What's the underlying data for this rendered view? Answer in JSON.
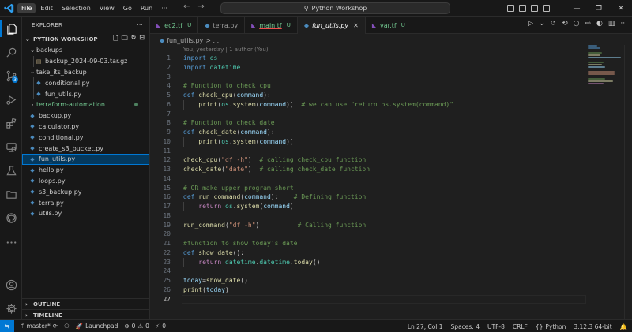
{
  "window": {
    "menu": [
      "File",
      "Edit",
      "Selection",
      "View",
      "Go",
      "Run",
      "···"
    ],
    "search_title": "Python Workshop",
    "controls": [
      "—",
      "❐",
      "✕"
    ]
  },
  "explorer": {
    "header": "EXPLORER",
    "header_more": "···",
    "project": "PYTHON WORKSHOP",
    "tree": [
      {
        "label": "backups",
        "type": "folder",
        "open": true,
        "depth": 0
      },
      {
        "label": "backup_2024-09-03.tar.gz",
        "type": "tar",
        "depth": 1
      },
      {
        "label": "take_its_backup",
        "type": "folder",
        "open": true,
        "depth": 0
      },
      {
        "label": "conditional.py",
        "type": "py",
        "depth": 1
      },
      {
        "label": "fun_utils.py",
        "type": "py",
        "depth": 1
      },
      {
        "label": "terraform-automation",
        "type": "folder",
        "open": false,
        "depth": 0,
        "untracked": true
      },
      {
        "label": "backup.py",
        "type": "py",
        "depth": 0
      },
      {
        "label": "calculator.py",
        "type": "py",
        "depth": 0
      },
      {
        "label": "conditional.py",
        "type": "py",
        "depth": 0
      },
      {
        "label": "create_s3_bucket.py",
        "type": "py",
        "depth": 0
      },
      {
        "label": "fun_utils.py",
        "type": "py",
        "depth": 0,
        "selected": true
      },
      {
        "label": "hello.py",
        "type": "py",
        "depth": 0
      },
      {
        "label": "loops.py",
        "type": "py",
        "depth": 0
      },
      {
        "label": "s3_backup.py",
        "type": "py",
        "depth": 0
      },
      {
        "label": "terra.py",
        "type": "py",
        "depth": 0
      },
      {
        "label": "utils.py",
        "type": "py",
        "depth": 0
      }
    ],
    "outline": "OUTLINE",
    "timeline": "TIMELINE"
  },
  "activity": {
    "scm_badge": "3"
  },
  "tabs": [
    {
      "label": "ec2.tf",
      "icon": "tf",
      "status": "U",
      "active": false
    },
    {
      "label": "terra.py",
      "icon": "py",
      "status": "",
      "active": false
    },
    {
      "label": "main.tf",
      "icon": "tf",
      "status": "U",
      "active": false
    },
    {
      "label": "fun_utils.py",
      "icon": "py",
      "status": "",
      "active": true,
      "close": "✕"
    },
    {
      "label": "var.tf",
      "icon": "tf",
      "status": "U",
      "active": false
    }
  ],
  "breadcrumb": {
    "file": "fun_utils.py",
    "rest": "> ..."
  },
  "blame": "You, yesterday | 1 author (You)",
  "cursor_line": 27,
  "code": [
    [
      [
        "kw",
        "import"
      ],
      [
        "plain",
        " "
      ],
      [
        "mod",
        "os"
      ]
    ],
    [
      [
        "kw",
        "import"
      ],
      [
        "plain",
        " "
      ],
      [
        "mod",
        "datetime"
      ]
    ],
    [],
    [
      [
        "com",
        "# Function to check cpu"
      ]
    ],
    [
      [
        "kw",
        "def"
      ],
      [
        "plain",
        " "
      ],
      [
        "fn",
        "check_cpu"
      ],
      [
        "plain",
        "("
      ],
      [
        "var",
        "command"
      ],
      [
        "plain",
        "):"
      ]
    ],
    [
      [
        "plain",
        "    "
      ],
      [
        "fn",
        "print"
      ],
      [
        "plain",
        "("
      ],
      [
        "mod",
        "os"
      ],
      [
        "plain",
        "."
      ],
      [
        "fn",
        "system"
      ],
      [
        "plain",
        "("
      ],
      [
        "var",
        "command"
      ],
      [
        "plain",
        "))  "
      ],
      [
        "com",
        "# we can use \"return os.system(command)\""
      ]
    ],
    [],
    [
      [
        "com",
        "# Function to check date"
      ]
    ],
    [
      [
        "kw",
        "def"
      ],
      [
        "plain",
        " "
      ],
      [
        "fn",
        "check_date"
      ],
      [
        "plain",
        "("
      ],
      [
        "var",
        "command"
      ],
      [
        "plain",
        "):"
      ]
    ],
    [
      [
        "plain",
        "    "
      ],
      [
        "fn",
        "print"
      ],
      [
        "plain",
        "("
      ],
      [
        "mod",
        "os"
      ],
      [
        "plain",
        "."
      ],
      [
        "fn",
        "system"
      ],
      [
        "plain",
        "("
      ],
      [
        "var",
        "command"
      ],
      [
        "plain",
        "))"
      ]
    ],
    [],
    [
      [
        "fn",
        "check_cpu"
      ],
      [
        "plain",
        "("
      ],
      [
        "str",
        "\"df -h\""
      ],
      [
        "plain",
        ")  "
      ],
      [
        "com",
        "# calling check_cpu function"
      ]
    ],
    [
      [
        "fn",
        "check_date"
      ],
      [
        "plain",
        "("
      ],
      [
        "str",
        "\"date\""
      ],
      [
        "plain",
        ")  "
      ],
      [
        "com",
        "# calling check_date function"
      ]
    ],
    [],
    [
      [
        "com",
        "# OR make upper program short"
      ]
    ],
    [
      [
        "kw",
        "def"
      ],
      [
        "plain",
        " "
      ],
      [
        "fn",
        "run_command"
      ],
      [
        "plain",
        "("
      ],
      [
        "var",
        "command"
      ],
      [
        "plain",
        "):    "
      ],
      [
        "com",
        "# Defining function"
      ]
    ],
    [
      [
        "plain",
        "    "
      ],
      [
        "ctl",
        "return"
      ],
      [
        "plain",
        " "
      ],
      [
        "mod",
        "os"
      ],
      [
        "plain",
        "."
      ],
      [
        "fn",
        "system"
      ],
      [
        "plain",
        "("
      ],
      [
        "var",
        "command"
      ],
      [
        "plain",
        ")"
      ]
    ],
    [],
    [
      [
        "fn",
        "run_command"
      ],
      [
        "plain",
        "("
      ],
      [
        "str",
        "\"df -h\""
      ],
      [
        "plain",
        ")          "
      ],
      [
        "com",
        "# Calling function"
      ]
    ],
    [],
    [
      [
        "com",
        "#function to show today's date"
      ]
    ],
    [
      [
        "kw",
        "def"
      ],
      [
        "plain",
        " "
      ],
      [
        "fn",
        "show_date"
      ],
      [
        "plain",
        "():"
      ]
    ],
    [
      [
        "plain",
        "    "
      ],
      [
        "ctl",
        "return"
      ],
      [
        "plain",
        " "
      ],
      [
        "mod",
        "datetime"
      ],
      [
        "plain",
        "."
      ],
      [
        "mod",
        "datetime"
      ],
      [
        "plain",
        "."
      ],
      [
        "fn",
        "today"
      ],
      [
        "plain",
        "()"
      ]
    ],
    [],
    [
      [
        "var",
        "today"
      ],
      [
        "plain",
        "="
      ],
      [
        "fn",
        "show_date"
      ],
      [
        "plain",
        "()"
      ]
    ],
    [
      [
        "fn",
        "print"
      ],
      [
        "plain",
        "("
      ],
      [
        "var",
        "today"
      ],
      [
        "plain",
        ")"
      ]
    ],
    []
  ],
  "status": {
    "remote": "⇆",
    "branch": "master*",
    "launchpad": "Launchpad",
    "errors": "0",
    "warnings": "0",
    "ports": "0",
    "position": "Ln 27, Col 1",
    "spaces": "Spaces: 4",
    "encoding": "UTF-8",
    "eol": "CRLF",
    "language": "Python",
    "interpreter": "3.12.3 64-bit"
  },
  "colors": {
    "accent": "#0078d4",
    "untracked": "#73c991",
    "selection": "#04395e"
  }
}
